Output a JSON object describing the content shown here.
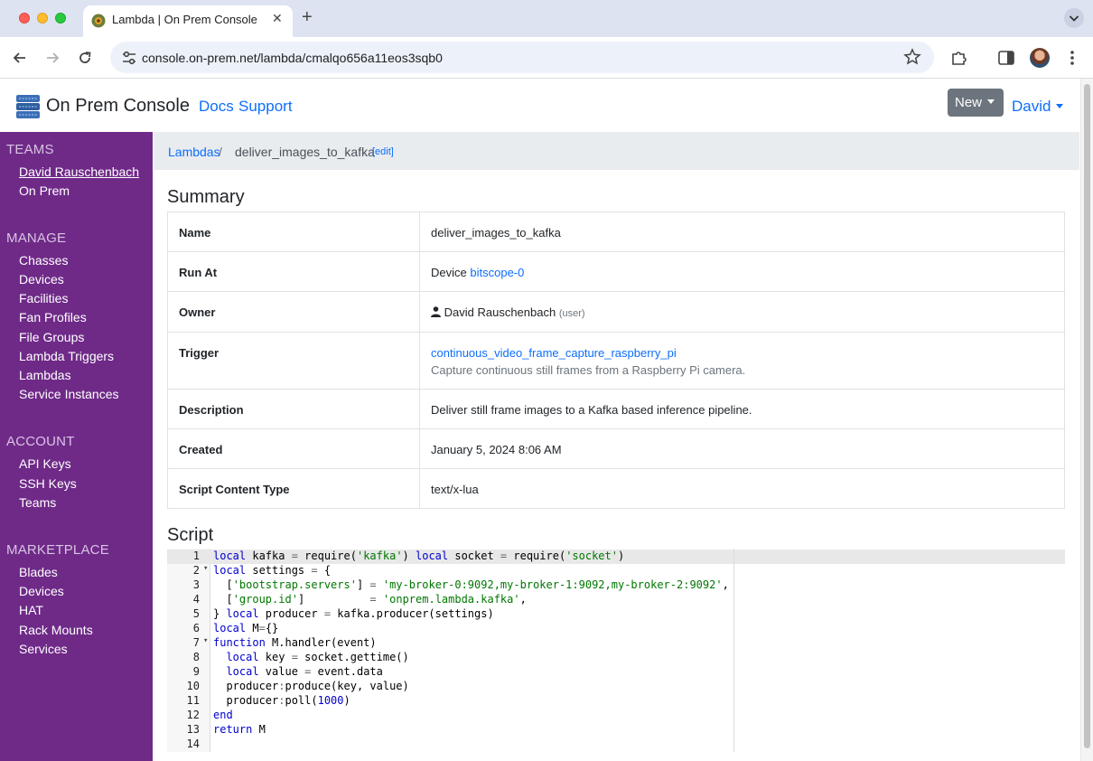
{
  "browser": {
    "tab_title": "Lambda | On Prem Console",
    "url": "console.on-prem.net/lambda/cmalqo656a11eos3sqb0"
  },
  "navbar": {
    "brand": "On Prem Console",
    "links": [
      "Docs",
      "Support"
    ],
    "new_button": "New",
    "user": "David"
  },
  "sidebar": {
    "sections": [
      {
        "title": "TEAMS",
        "items": [
          "David Rauschenbach",
          "On Prem"
        ]
      },
      {
        "title": "MANAGE",
        "items": [
          "Chasses",
          "Devices",
          "Facilities",
          "Fan Profiles",
          "File Groups",
          "Lambda Triggers",
          "Lambdas",
          "Service Instances"
        ]
      },
      {
        "title": "ACCOUNT",
        "items": [
          "API Keys",
          "SSH Keys",
          "Teams"
        ]
      },
      {
        "title": "MARKETPLACE",
        "items": [
          "Blades",
          "Devices",
          "HAT",
          "Rack Mounts",
          "Services"
        ]
      }
    ]
  },
  "breadcrumb": {
    "parent": "Lambdas",
    "separator": "/",
    "current": "deliver_images_to_kafka",
    "edit": "[edit]"
  },
  "summary": {
    "title": "Summary",
    "rows": {
      "name": {
        "label": "Name",
        "value": "deliver_images_to_kafka"
      },
      "run_at": {
        "label": "Run At",
        "prefix": "Device",
        "link": "bitscope-0"
      },
      "owner": {
        "label": "Owner",
        "value": "David Rauschenbach",
        "role": "(user)"
      },
      "trigger": {
        "label": "Trigger",
        "link": "continuous_video_frame_capture_raspberry_pi",
        "description": "Capture continuous still frames from a Raspberry Pi camera."
      },
      "description": {
        "label": "Description",
        "value": "Deliver still frame images to a Kafka based inference pipeline."
      },
      "created": {
        "label": "Created",
        "value": "January 5, 2024 8:06 AM"
      },
      "content_type": {
        "label": "Script Content Type",
        "value": "text/x-lua"
      }
    }
  },
  "script": {
    "title": "Script",
    "lines": [
      "local kafka = require('kafka') local socket = require('socket')",
      "local settings = {",
      "  ['bootstrap.servers'] = 'my-broker-0:9092,my-broker-1:9092,my-broker-2:9092',",
      "  ['group.id']          = 'onprem.lambda.kafka',",
      "} local producer = kafka.producer(settings)",
      "local M={}",
      "function M.handler(event)",
      "  local key = socket.gettime()",
      "  local value = event.data",
      "  producer:produce(key, value)",
      "  producer:poll(1000)",
      "end",
      "return M",
      ""
    ],
    "fold_lines": [
      2,
      7
    ]
  },
  "colors": {
    "sidebar": "#6f2a88",
    "link": "#0d6efd",
    "button": "#6c757d"
  }
}
